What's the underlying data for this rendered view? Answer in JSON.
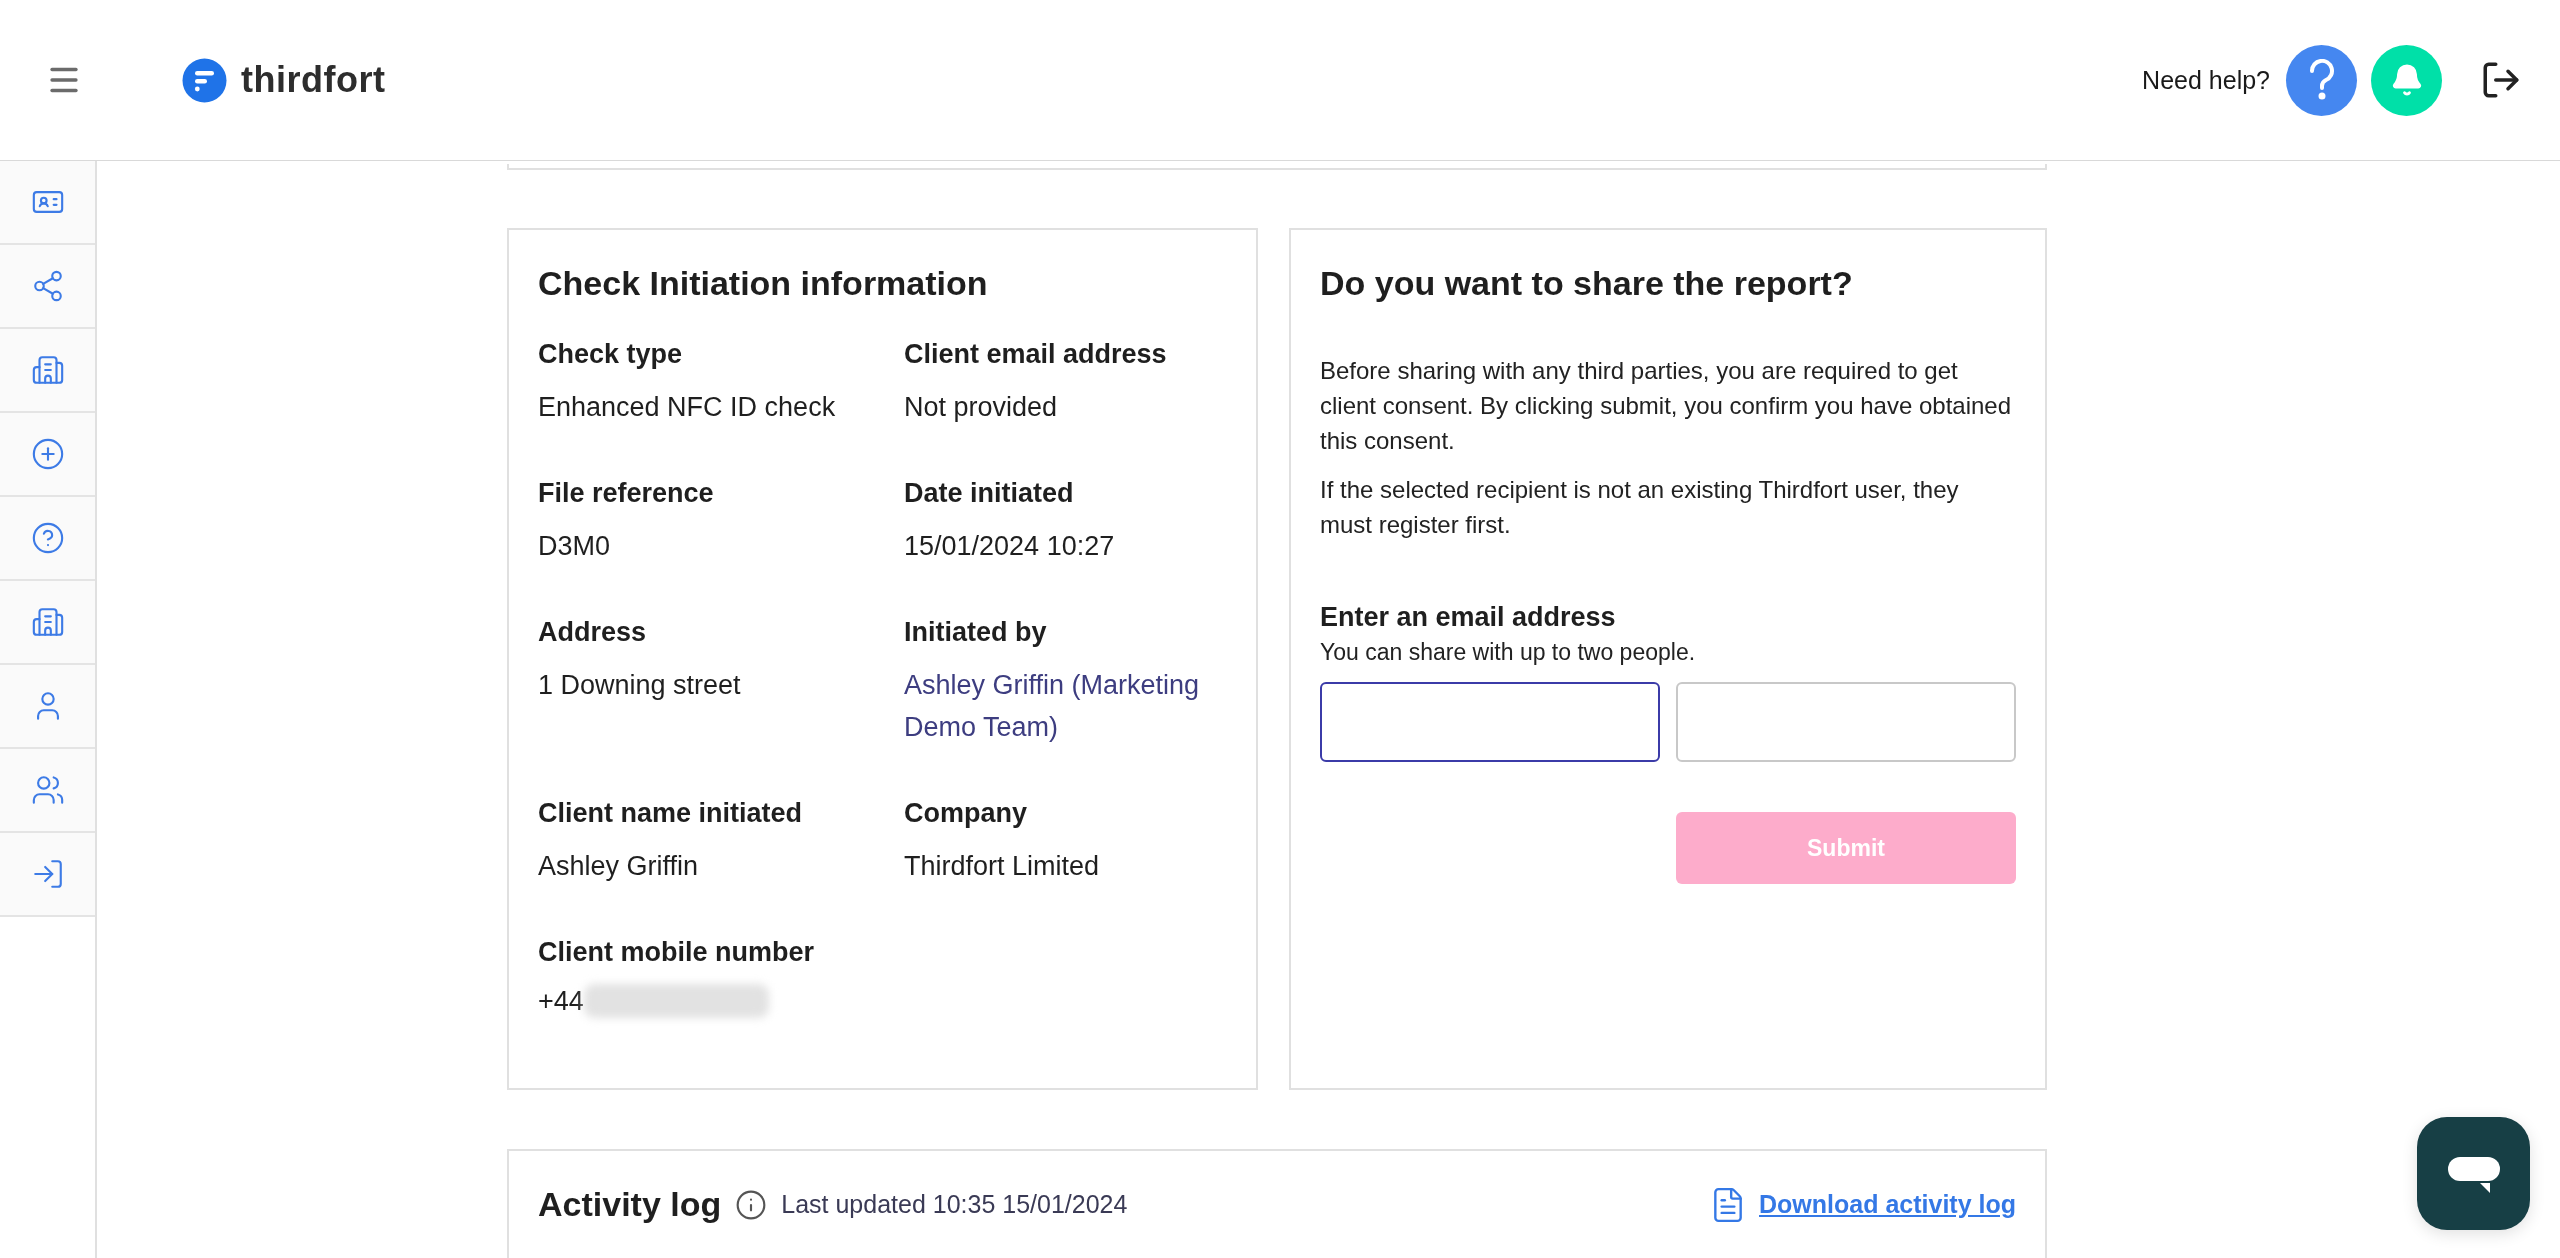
{
  "header": {
    "brand": "thirdfort",
    "help_label": "Need help?"
  },
  "sidebar": {
    "items": [
      {
        "kind": "id-check"
      },
      {
        "kind": "share"
      },
      {
        "kind": "buildings-check"
      },
      {
        "kind": "add"
      },
      {
        "kind": "help"
      },
      {
        "kind": "buildings-people"
      },
      {
        "kind": "user"
      },
      {
        "kind": "users"
      },
      {
        "kind": "sign-in"
      }
    ]
  },
  "check_info": {
    "title": "Check Initiation information",
    "fields": [
      {
        "label": "Check type",
        "value": "Enhanced NFC ID check",
        "kind": "text"
      },
      {
        "label": "Client email address",
        "value": "Not provided",
        "kind": "text"
      },
      {
        "label": "File reference",
        "value": "D3M0",
        "kind": "text"
      },
      {
        "label": "Date initiated",
        "value": "15/01/2024 10:27",
        "kind": "text"
      },
      {
        "label": "Address",
        "value": "1 Downing street",
        "kind": "text"
      },
      {
        "label": "Initiated by",
        "value": "Ashley Griffin (Marketing Demo Team)",
        "kind": "link"
      },
      {
        "label": "Client name initiated",
        "value": "Ashley Griffin",
        "kind": "text"
      },
      {
        "label": "Company",
        "value": "Thirdfort Limited",
        "kind": "text"
      },
      {
        "label": "Client mobile number",
        "value": "+44",
        "kind": "redacted"
      }
    ]
  },
  "share": {
    "title": "Do you want to share the report?",
    "paragraphs": [
      "Before sharing with any third parties, you are required to get client consent. By clicking submit, you confirm you have obtained this consent.",
      "If the selected recipient is not an existing Thirdfort user, they must register first."
    ],
    "email_label": "Enter an email address",
    "email_hint": "You can share with up to two people.",
    "inputs": [
      {
        "focused": true
      },
      {
        "focused": false
      }
    ],
    "submit": {
      "label": "Submit",
      "disabled": true
    }
  },
  "activity_log": {
    "title": "Activity log",
    "last_updated": "Last updated 10:35 15/01/2024",
    "download": "Download activity log"
  }
}
